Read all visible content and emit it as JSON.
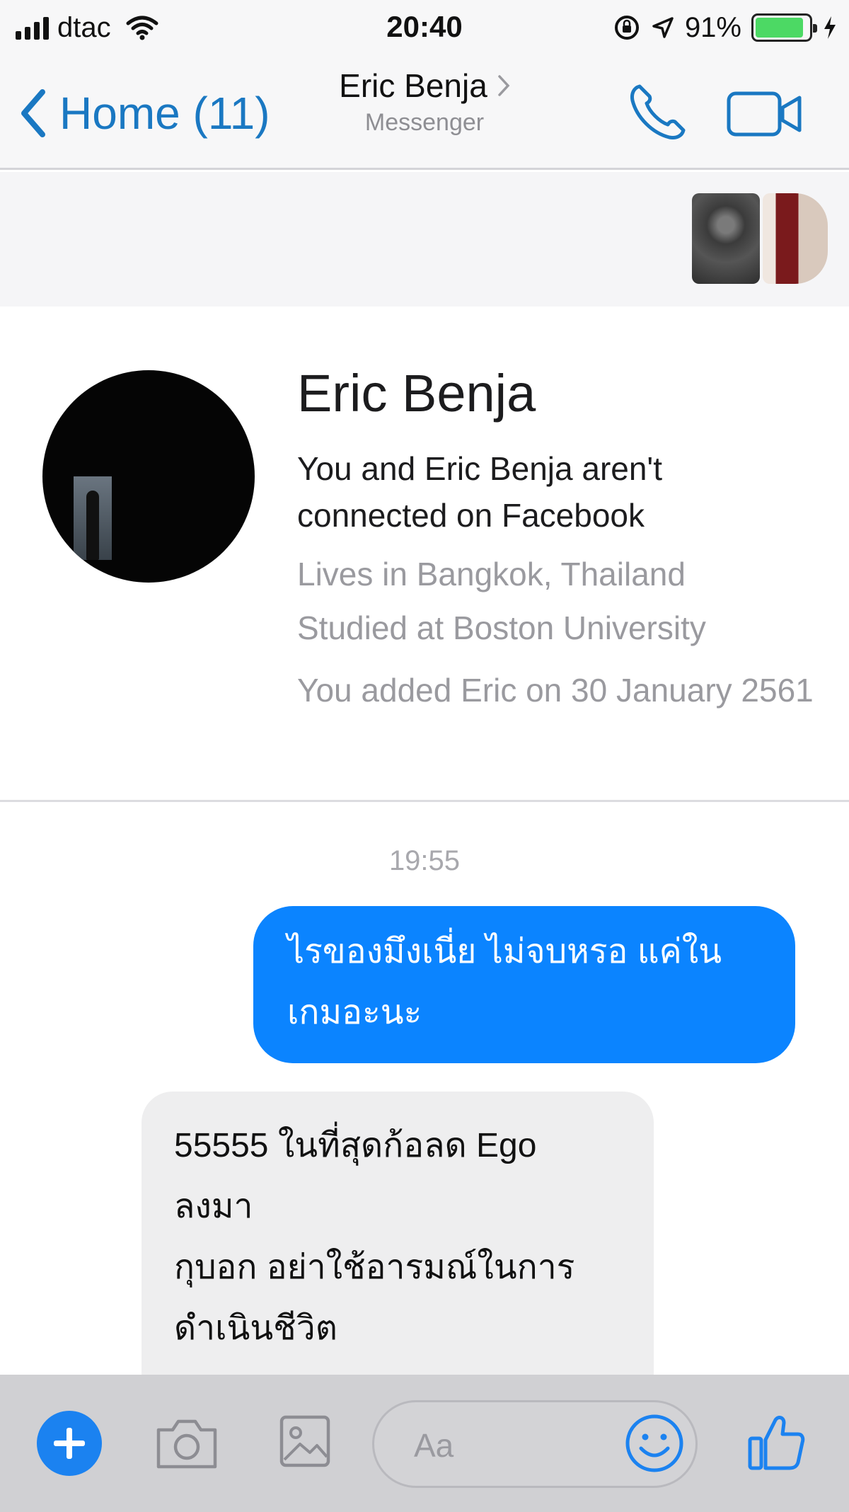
{
  "status_bar": {
    "carrier": "dtac",
    "time": "20:40",
    "battery_percent": "91%",
    "battery_level": 0.91
  },
  "nav": {
    "back_label": "Home (11)",
    "title": "Eric Benja",
    "subtitle": "Messenger"
  },
  "profile": {
    "name": "Eric Benja",
    "connection": "You and Eric Benja aren't connected on Facebook",
    "lives": "Lives in Bangkok, Thailand",
    "studied": "Studied at Boston University",
    "added": "You added Eric on 30 January 2561"
  },
  "conversation": {
    "timestamp": "19:55",
    "sent_message": "ไรของมึงเนี่ย ไม่จบหรอ แค่ในเกมอะนะ",
    "received_message_line1": "55555 ในที่สุดก้อลด Ego ลงมา",
    "received_message_line2": "กุบอก อย่าใช้อารมณ์ในการดำเนินชีวิต"
  },
  "composer": {
    "placeholder": "Aa"
  },
  "colors": {
    "accent": "#1a78c2",
    "sent_bubble": "#0b84ff",
    "received_bubble": "#eeeeef",
    "battery": "#4cd964"
  },
  "icons": [
    "signal-icon",
    "wifi-icon",
    "lock-rotation-icon",
    "location-icon",
    "battery-icon",
    "charging-icon",
    "chevron-left-icon",
    "chevron-right-icon",
    "phone-icon",
    "video-camera-icon",
    "plus-icon",
    "camera-icon",
    "gallery-icon",
    "emoji-icon",
    "thumbs-up-icon"
  ]
}
